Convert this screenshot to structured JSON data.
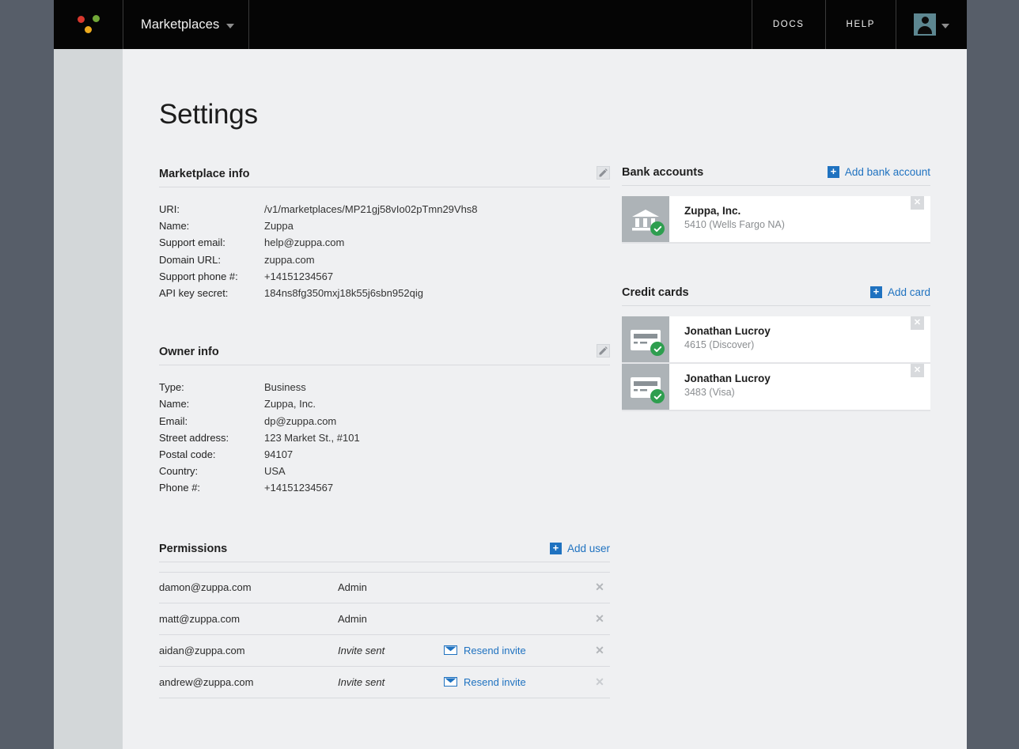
{
  "nav": {
    "logo": {
      "name": "balanced-logo",
      "dots": [
        "#d8382e",
        "#72a838",
        "#edab1e"
      ]
    },
    "marketplaces_label": "Marketplaces",
    "docs_label": "DOCS",
    "help_label": "HELP",
    "account_icon": "user-avatar-icon"
  },
  "page": {
    "title": "Settings"
  },
  "marketplace_info": {
    "title": "Marketplace info",
    "edit_icon": "edit-pencil-icon",
    "fields": [
      {
        "label": "URI:",
        "value": "/v1/marketplaces/MP21gj58vIo02pTmn29Vhs8"
      },
      {
        "label": "Name:",
        "value": "Zuppa"
      },
      {
        "label": "Support email:",
        "value": "help@zuppa.com"
      },
      {
        "label": "Domain URL:",
        "value": "zuppa.com"
      },
      {
        "label": "Support phone #:",
        "value": "+14151234567"
      },
      {
        "label": "API key secret:",
        "value": "184ns8fg350mxj18k55j6sbn952qig"
      }
    ]
  },
  "owner_info": {
    "title": "Owner info",
    "edit_icon": "edit-pencil-icon",
    "fields": [
      {
        "label": "Type:",
        "value": "Business"
      },
      {
        "label": "Name:",
        "value": "Zuppa, Inc."
      },
      {
        "label": "Email:",
        "value": "dp@zuppa.com"
      },
      {
        "label": "Street address:",
        "value": "123 Market St., #101"
      },
      {
        "label": "Postal code:",
        "value": "94107"
      },
      {
        "label": "Country:",
        "value": "USA"
      },
      {
        "label": "Phone #:",
        "value": "+14151234567"
      }
    ]
  },
  "permissions": {
    "title": "Permissions",
    "add_label": "Add user",
    "add_icon": "plus-icon",
    "rows": [
      {
        "email": "damon@zuppa.com",
        "role": "Admin",
        "pending": false,
        "action": "",
        "remove": "✕"
      },
      {
        "email": "matt@zuppa.com",
        "role": "Admin",
        "pending": false,
        "action": "",
        "remove": "✕"
      },
      {
        "email": "aidan@zuppa.com",
        "role": "Invite sent",
        "pending": true,
        "action": "Resend invite",
        "remove": "✕"
      },
      {
        "email": "andrew@zuppa.com",
        "role": "Invite sent",
        "pending": true,
        "action": "Resend invite",
        "remove": "✕"
      }
    ]
  },
  "bank_accounts": {
    "title": "Bank accounts",
    "add_label": "Add bank account",
    "add_icon": "plus-icon",
    "items": [
      {
        "name": "Zuppa, Inc.",
        "detail": "5410 (Wells Fargo NA)",
        "icon": "bank-icon",
        "verified": true,
        "remove": "✕"
      }
    ]
  },
  "credit_cards": {
    "title": "Credit cards",
    "add_label": "Add card",
    "add_icon": "plus-icon",
    "items": [
      {
        "name": "Jonathan Lucroy",
        "detail": "4615 (Discover)",
        "icon": "credit-card-icon",
        "verified": true,
        "remove": "✕"
      },
      {
        "name": "Jonathan Lucroy",
        "detail": "3483 (Visa)",
        "icon": "credit-card-icon",
        "verified": true,
        "remove": "✕"
      }
    ]
  },
  "colors": {
    "accent_blue": "#1f72c0",
    "verified_green": "#2e9e4f",
    "nav_background": "#050505",
    "page_background": "#eff0f2",
    "chrome_background": "#575e69"
  }
}
